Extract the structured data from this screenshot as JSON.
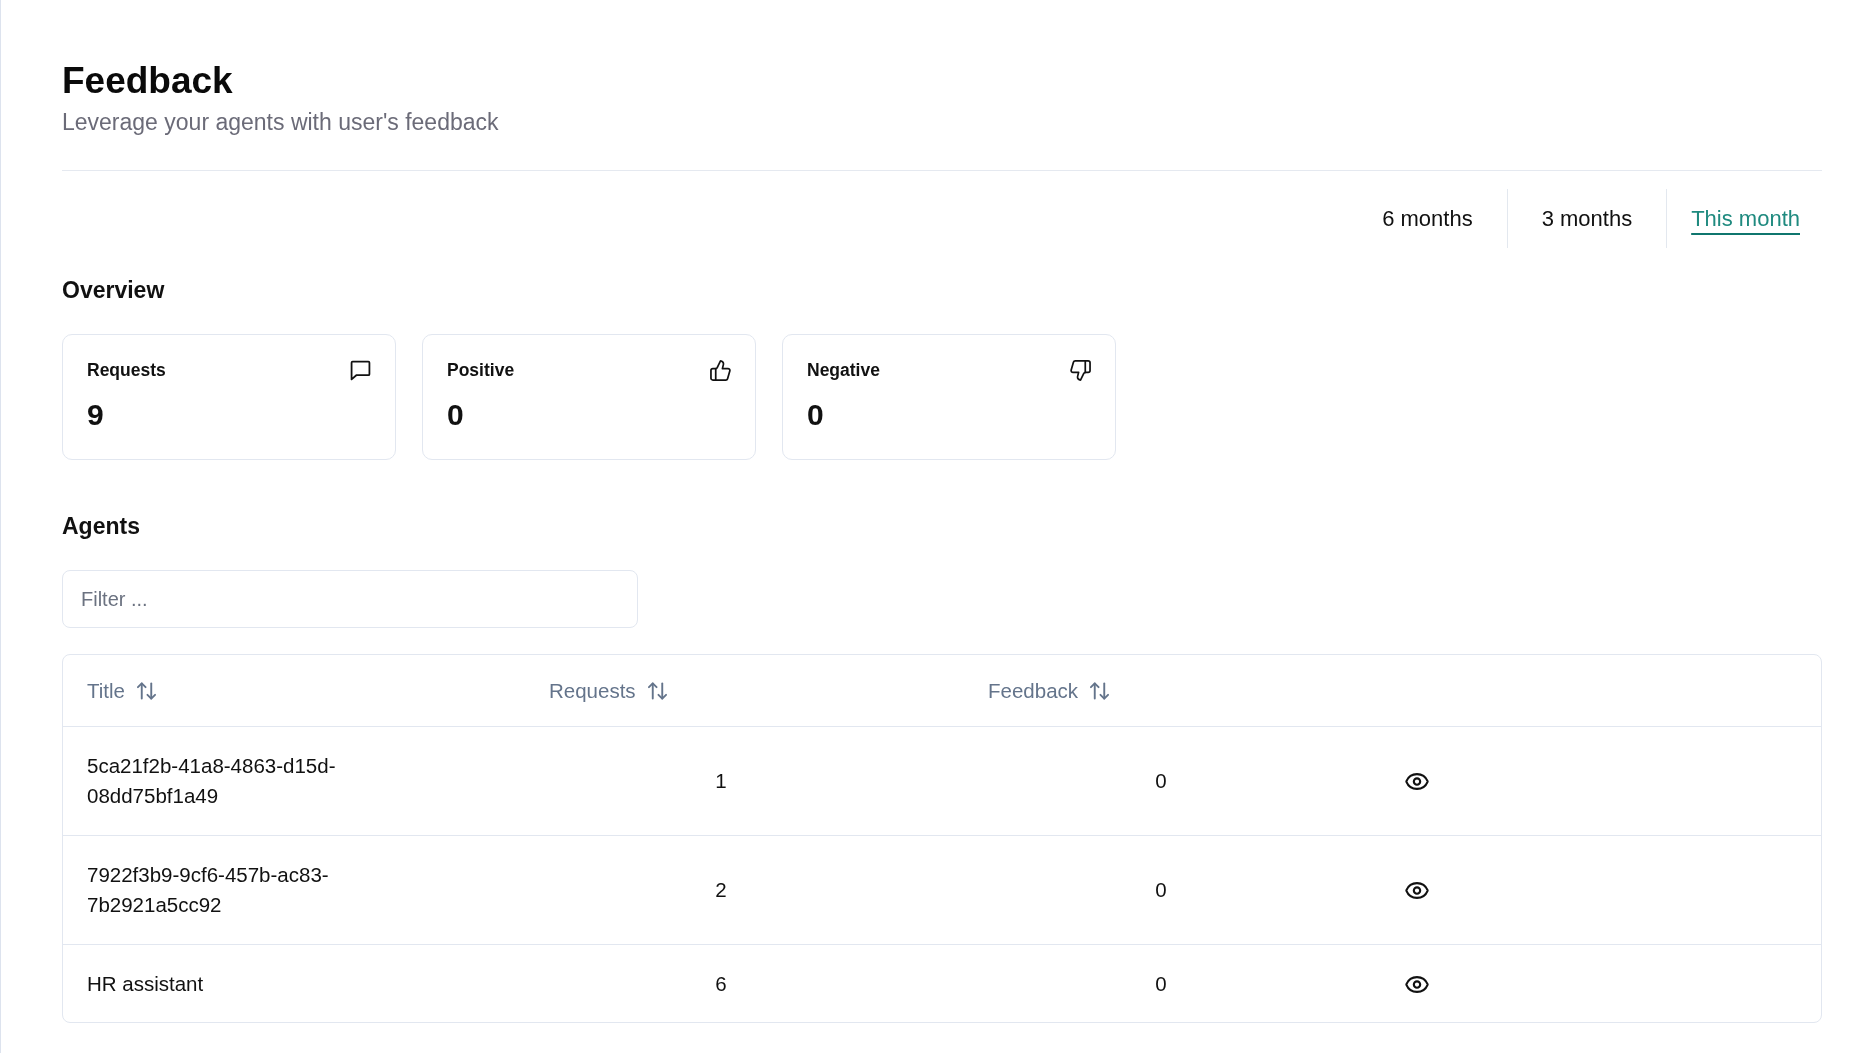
{
  "page": {
    "title": "Feedback",
    "subtitle": "Leverage your agents with user's feedback"
  },
  "period_tabs": [
    {
      "label": "6 months",
      "selected": false
    },
    {
      "label": "3 months",
      "selected": false
    },
    {
      "label": "This month",
      "selected": true
    }
  ],
  "overview": {
    "title": "Overview",
    "cards": [
      {
        "kind": "requests",
        "label": "Requests",
        "value": "9"
      },
      {
        "kind": "positive",
        "label": "Positive",
        "value": "0"
      },
      {
        "kind": "negative",
        "label": "Negative",
        "value": "0"
      }
    ]
  },
  "agents": {
    "title": "Agents",
    "filter": {
      "placeholder": "Filter ..."
    },
    "table": {
      "columns": [
        {
          "label": "Title"
        },
        {
          "label": "Requests"
        },
        {
          "label": "Feedback"
        }
      ],
      "rows": [
        {
          "title": "5ca21f2b-41a8-4863-d15d-08dd75bf1a49",
          "requests": "1",
          "feedback": "0"
        },
        {
          "title": "7922f3b9-9cf6-457b-ac83-7b2921a5cc92",
          "requests": "2",
          "feedback": "0"
        },
        {
          "title": "HR assistant",
          "requests": "6",
          "feedback": "0"
        }
      ]
    }
  }
}
